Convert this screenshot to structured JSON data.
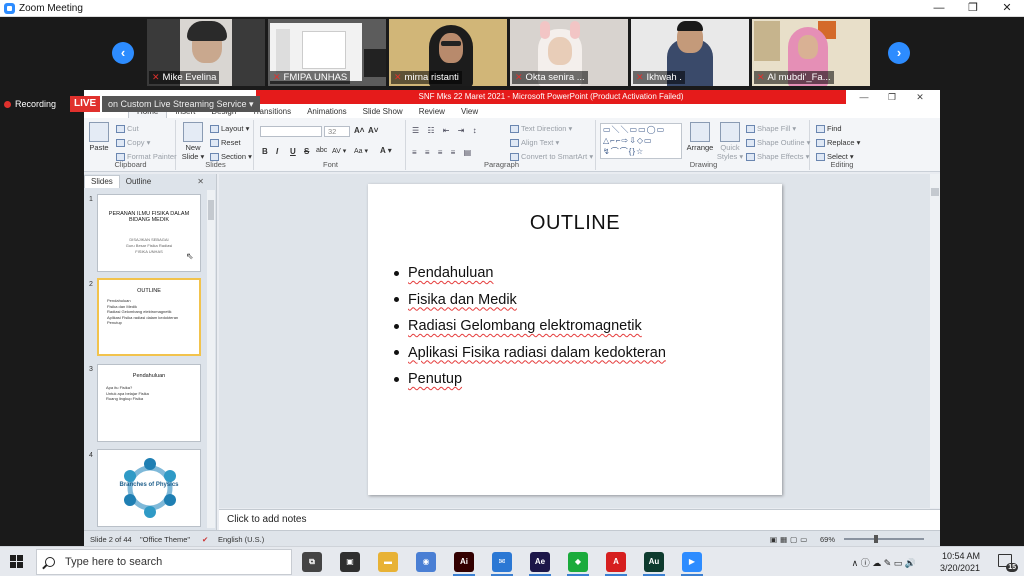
{
  "zoom": {
    "title": "Zoom Meeting",
    "window_controls": [
      "—",
      "❐",
      "✕"
    ],
    "nav_prev": "‹",
    "nav_next": "›",
    "participants": [
      {
        "name": "Mike Evelina"
      },
      {
        "name": "FMIPA UNHAS"
      },
      {
        "name": "mirna ristanti"
      },
      {
        "name": "Okta senira ..."
      },
      {
        "name": "Ikhwah ."
      },
      {
        "name": "Al mubdi'_Fa..."
      }
    ],
    "mic_muted_icon": "mic-muted-icon",
    "recording_label": "Recording",
    "live_badge": "LIVE",
    "live_service": "on Custom Live Streaming Service ▾"
  },
  "ppt": {
    "title_bar_text": "SNF Mks 22 Maret 2021 - Microsoft PowerPoint (Product Activation Failed)",
    "window_controls": [
      "—",
      "❐",
      "✕"
    ],
    "tabs": [
      "File",
      "Home",
      "Insert",
      "Design",
      "Transitions",
      "Animations",
      "Slide Show",
      "Review",
      "View"
    ],
    "active_tab": "Home",
    "ribbon": {
      "clipboard": {
        "label": "Clipboard",
        "paste": "Paste",
        "cut": "Cut",
        "copy": "Copy ▾",
        "format_painter": "Format Painter"
      },
      "slides": {
        "label": "Slides",
        "new_slide": "New Slide ▾",
        "layout": "Layout ▾",
        "reset": "Reset",
        "section": "Section ▾"
      },
      "font": {
        "label": "Font",
        "size": "32",
        "bold": "B",
        "italic": "I",
        "underline": "U",
        "strike": "S",
        "shadow": "abc",
        "spacing": "AV ▾",
        "case": "Aa ▾",
        "color": "A ▾",
        "grow": "A˄",
        "shrink": "A˅"
      },
      "paragraph": {
        "label": "Paragraph",
        "text_direction": "Text Direction ▾",
        "align_text": "Align Text ▾",
        "convert_smartart": "Convert to SmartArt ▾"
      },
      "drawing": {
        "label": "Drawing",
        "arrange": "Arrange",
        "quick_styles": "Quick Styles ▾",
        "shape_fill": "Shape Fill ▾",
        "shape_outline": "Shape Outline ▾",
        "shape_effects": "Shape Effects ▾"
      },
      "editing": {
        "label": "Editing",
        "find": "Find",
        "replace": "Replace ▾",
        "select": "Select ▾"
      }
    },
    "panel": {
      "tab_slides": "Slides",
      "tab_outline": "Outline",
      "close": "✕",
      "thumbs": [
        {
          "num": "1",
          "title": "PERANAN ILMU FISIKA DALAM BIDANG MEDIK",
          "sub": [
            "DISAJIKAN SEBAGAI",
            "Guru Besar Fisika Radiasi",
            "FISIKA UNHAS"
          ]
        },
        {
          "num": "2",
          "title": "OUTLINE",
          "items": [
            "Pendahuluan",
            "Fisika dan Medik",
            "Radiasi Gelombang elektromagnetik",
            "Aplikasi Fisika radiasi dalam kedokteran",
            "Penutup"
          ]
        },
        {
          "num": "3",
          "title": "Pendahuluan",
          "items": [
            "Apa itu Fisika?",
            "Untuk apa belajar Fisika",
            "Ruang lingkup Fisika"
          ]
        },
        {
          "num": "4",
          "center_text": "Branches of Physics"
        }
      ]
    },
    "slide": {
      "title": "OUTLINE",
      "bullets": [
        "Pendahuluan",
        "Fisika dan Medik",
        "Radiasi Gelombang  elektromagnetik",
        "Aplikasi Fisika radiasi dalam kedokteran",
        "Penutup"
      ]
    },
    "notes_placeholder": "Click to add notes",
    "status": {
      "slide_info": "Slide 2 of 44",
      "theme": "\"Office Theme\"",
      "language": "English (U.S.)",
      "zoom": "69%"
    }
  },
  "taskbar": {
    "search_placeholder": "Type here to search",
    "apps": [
      {
        "name": "task-view",
        "label": "⧉",
        "color": "#444444"
      },
      {
        "name": "store",
        "label": "▣",
        "color": "#2f2f2f"
      },
      {
        "name": "file-explorer",
        "label": "▬",
        "color": "#e8b235"
      },
      {
        "name": "media-player",
        "label": "◉",
        "color": "#4a7fd4"
      },
      {
        "name": "illustrator",
        "label": "Ai",
        "color": "#330000"
      },
      {
        "name": "mail",
        "label": "✉",
        "color": "#2b78d4"
      },
      {
        "name": "after-effects",
        "label": "Ae",
        "color": "#1c1648"
      },
      {
        "name": "green-app",
        "label": "◆",
        "color": "#1bab3c"
      },
      {
        "name": "acrobat",
        "label": "A",
        "color": "#d61f1f"
      },
      {
        "name": "audition",
        "label": "Au",
        "color": "#0e3b2e"
      },
      {
        "name": "zoom",
        "label": "▶",
        "color": "#2d8cff"
      }
    ],
    "tray_icons": "∧  ⓘ  ☁  ✎  ▭  🔊",
    "time": "10:54 AM",
    "date": "3/20/2021",
    "notification_count": "15"
  }
}
